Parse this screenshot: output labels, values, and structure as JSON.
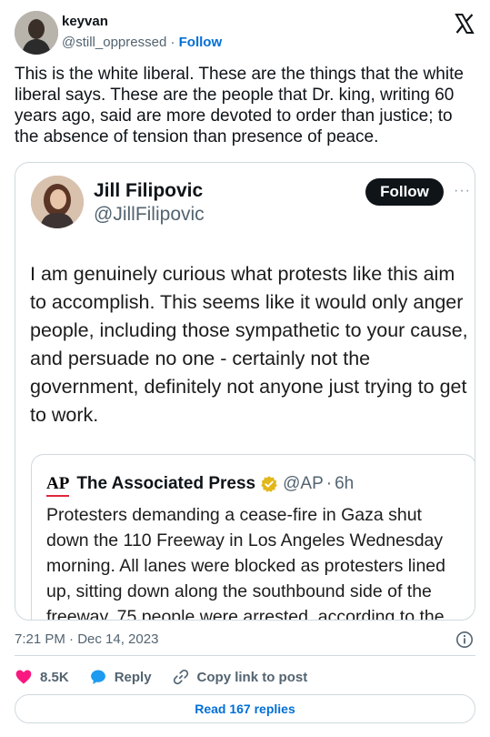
{
  "embed": {
    "author": {
      "name": "keyvan",
      "handle": "@still_oppressed",
      "separator": "·",
      "follow_label": "Follow"
    },
    "text": "This is the white liberal. These are the things that the white liberal says. These are the people that Dr. king, writing 60 years ago, said are more devoted to order than justice; to the absence of tension than presence of peace.",
    "timestamp": "7:21 PM · Dec 14, 2023",
    "actions": {
      "likes": "8.5K",
      "reply_label": "Reply",
      "copy_label": "Copy link to post"
    },
    "read_replies_label": "Read 167 replies",
    "colors": {
      "like": "#f91880",
      "reply": "#1d9bf0",
      "link": "#006fd6"
    }
  },
  "screenshot": {
    "author": {
      "name": "Jill Filipovic",
      "handle": "@JillFilipovic",
      "follow_label": "Follow",
      "more": "···"
    },
    "text": "I am genuinely curious what protests like this aim to accomplish. This seems like it would only anger people, including those sympathetic to your cause, and persuade no one - certainly not the government, definitely not anyone just trying to get to work.",
    "quote": {
      "logo": "AP",
      "name": "The Associated Press",
      "handle": "@AP",
      "separator": "·",
      "time": "6h",
      "text": "Protesters demanding a cease-fire in Gaza shut down the 110 Freeway in Los Angeles Wednesday morning. All lanes were blocked as protesters lined up, sitting down along the southbound side of the freeway. 75 people were arrested, according to the"
    }
  }
}
